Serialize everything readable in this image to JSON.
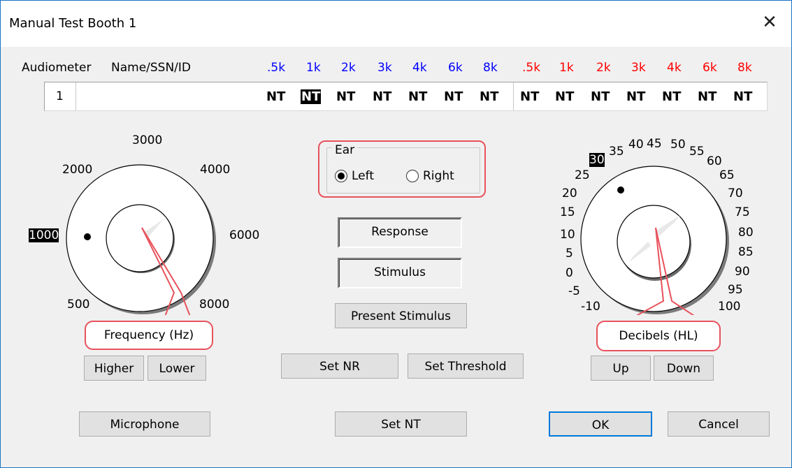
{
  "window": {
    "title": "Manual Test Booth 1",
    "close_glyph": "✕"
  },
  "header": {
    "audiometer": "Audiometer",
    "name": "Name/SSN/ID",
    "left_freqs": [
      ".5k",
      "1k",
      "2k",
      "3k",
      "4k",
      "6k",
      "8k"
    ],
    "right_freqs": [
      ".5k",
      "1k",
      "2k",
      "3k",
      "4k",
      "6k",
      "8k"
    ],
    "left_color": "#0000ff",
    "right_color": "#ff0000"
  },
  "row": {
    "number": "1",
    "name": "",
    "left_values": [
      "NT",
      "NT",
      "NT",
      "NT",
      "NT",
      "NT",
      "NT"
    ],
    "right_values": [
      "NT",
      "NT",
      "NT",
      "NT",
      "NT",
      "NT",
      "NT"
    ],
    "selected": "left-1k"
  },
  "frequency_dial": {
    "label": "Frequency (Hz)",
    "ticks": [
      "3000",
      "2000",
      "4000",
      "1000",
      "6000",
      "500",
      "8000"
    ],
    "selected": "1000"
  },
  "ear": {
    "legend": "Ear",
    "left": "Left",
    "right": "Right",
    "selected": "Left"
  },
  "indicators": {
    "response": "Response",
    "stimulus": "Stimulus"
  },
  "decibel_dial": {
    "label": "Decibels (HL)",
    "ticks": [
      "-10",
      "-5",
      "0",
      "5",
      "10",
      "15",
      "20",
      "25",
      "30",
      "35",
      "40",
      "45",
      "50",
      "55",
      "60",
      "65",
      "70",
      "75",
      "80",
      "85",
      "90",
      "95",
      "100"
    ],
    "selected": "30"
  },
  "buttons": {
    "present_stimulus": "Present Stimulus",
    "higher": "Higher",
    "lower": "Lower",
    "set_nr": "Set NR",
    "set_threshold": "Set Threshold",
    "up": "Up",
    "down": "Down",
    "microphone": "Microphone",
    "set_nt": "Set NT",
    "ok": "OK",
    "cancel": "Cancel"
  },
  "colors": {
    "accent": "#0078d7",
    "callout": "#e8525c"
  }
}
